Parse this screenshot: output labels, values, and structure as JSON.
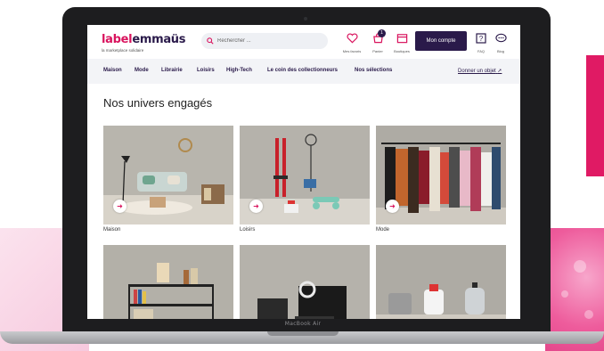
{
  "brand": {
    "logo_part1": "label",
    "logo_part2": "emmaüs",
    "logo_tagline": "la marketplace solidaire",
    "accent": "#d9145e",
    "primary": "#2a1a4a"
  },
  "search": {
    "placeholder": "Rechercher ..."
  },
  "header_icons": [
    {
      "icon": "heart-icon",
      "label": "Mes favoris"
    },
    {
      "icon": "cart-icon",
      "label": "Panier",
      "count": "1"
    },
    {
      "icon": "calendar-icon",
      "label": "Boutiques"
    }
  ],
  "account_button": "Mon compte",
  "help_icons": [
    {
      "icon": "help-icon",
      "label": "FAQ"
    },
    {
      "icon": "chat-icon",
      "label": "Blog"
    }
  ],
  "nav": {
    "items": [
      "Maison",
      "Mode",
      "Librairie",
      "Loisirs",
      "High-Tech",
      "Le coin des collectionneurs",
      "Nos sélections"
    ],
    "cta": "Donner un objet"
  },
  "section_title": "Nos univers engagés",
  "cards": [
    {
      "label": "Maison"
    },
    {
      "label": "Loisirs"
    },
    {
      "label": "Mode"
    },
    {
      "label": ""
    },
    {
      "label": ""
    },
    {
      "label": ""
    }
  ],
  "device_label": "MacBook Air"
}
